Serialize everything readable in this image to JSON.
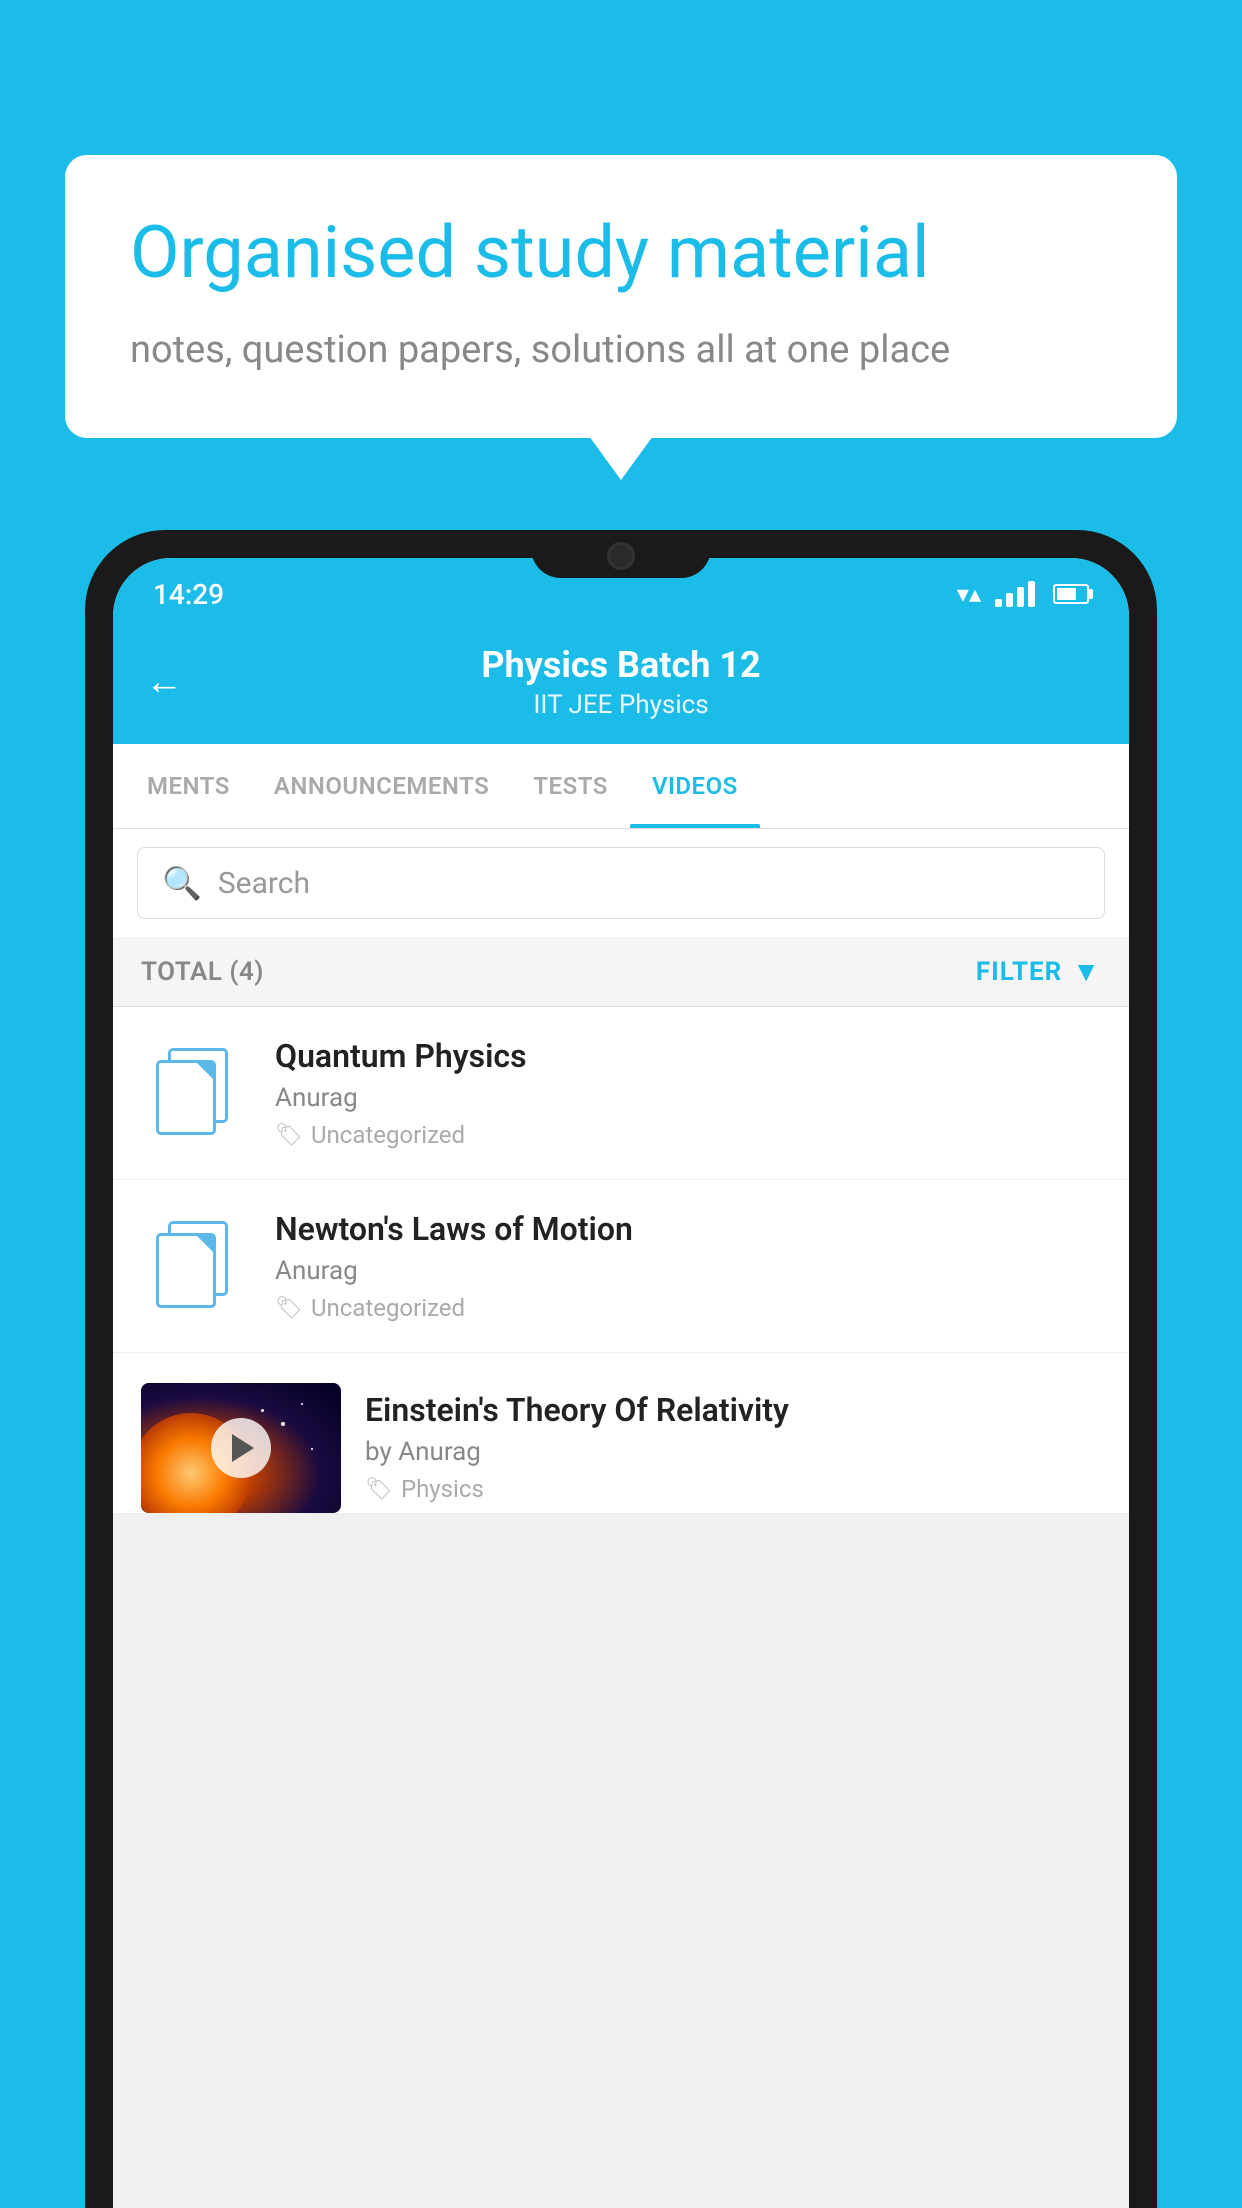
{
  "background_color": "#1bbde8",
  "speech_bubble": {
    "title": "Organised study material",
    "subtitle": "notes, question papers, solutions all at one place"
  },
  "status_bar": {
    "time": "14:29"
  },
  "app_header": {
    "back_label": "←",
    "title": "Physics Batch 12",
    "subtitle": "IIT JEE   Physics"
  },
  "tabs": [
    {
      "label": "MENTS",
      "active": false
    },
    {
      "label": "ANNOUNCEMENTS",
      "active": false
    },
    {
      "label": "TESTS",
      "active": false
    },
    {
      "label": "VIDEOS",
      "active": true
    }
  ],
  "search": {
    "placeholder": "Search"
  },
  "filter_bar": {
    "total_label": "TOTAL (4)",
    "filter_label": "FILTER"
  },
  "videos": [
    {
      "title": "Quantum Physics",
      "author": "Anurag",
      "tag": "Uncategorized",
      "has_thumbnail": false
    },
    {
      "title": "Newton's Laws of Motion",
      "author": "Anurag",
      "tag": "Uncategorized",
      "has_thumbnail": false
    },
    {
      "title": "Einstein's Theory Of Relativity",
      "author": "by Anurag",
      "tag": "Physics",
      "has_thumbnail": true
    }
  ]
}
